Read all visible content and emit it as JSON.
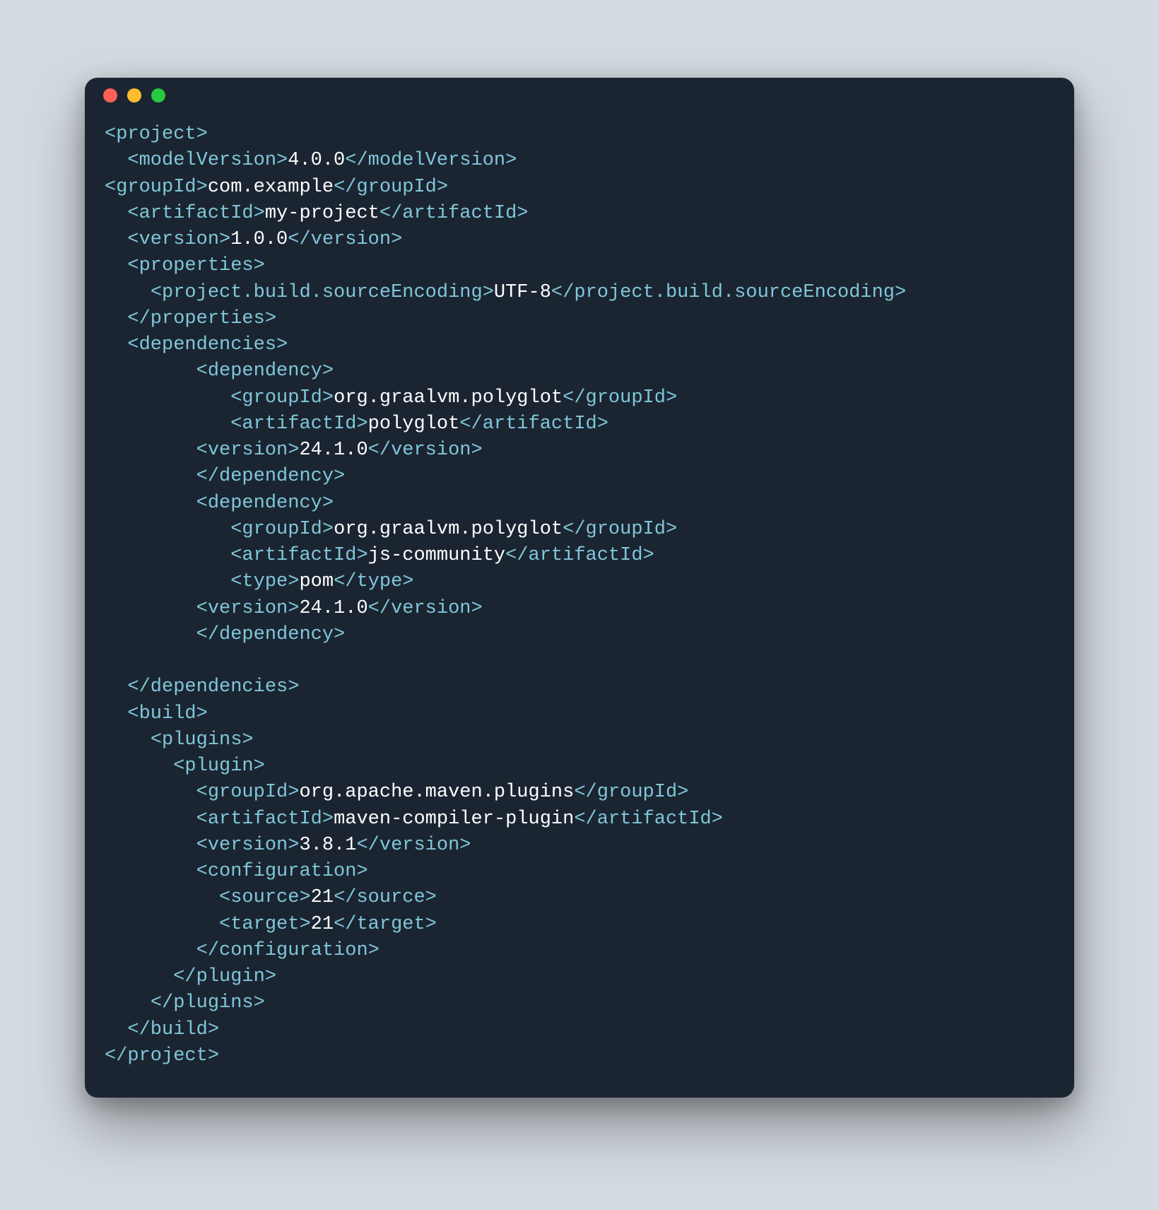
{
  "pom": {
    "modelVersion": "4.0.0",
    "groupId": "com.example",
    "artifactId": "my-project",
    "version": "1.0.0",
    "properties": {
      "project.build.sourceEncoding": "UTF-8"
    },
    "dependencies": [
      {
        "groupId": "org.graalvm.polyglot",
        "artifactId": "polyglot",
        "version": "24.1.0"
      },
      {
        "groupId": "org.graalvm.polyglot",
        "artifactId": "js-community",
        "type": "pom",
        "version": "24.1.0"
      }
    ],
    "build": {
      "plugins": [
        {
          "groupId": "org.apache.maven.plugins",
          "artifactId": "maven-compiler-plugin",
          "version": "3.8.1",
          "configuration": {
            "source": "21",
            "target": "21"
          }
        }
      ]
    }
  },
  "tags": {
    "project_open": "<project>",
    "project_close": "</project>",
    "modelVersion_open": "<modelVersion>",
    "modelVersion_close": "</modelVersion>",
    "groupId_open": "<groupId>",
    "groupId_close": "</groupId>",
    "artifactId_open": "<artifactId>",
    "artifactId_close": "</artifactId>",
    "version_open": "<version>",
    "version_close": "</version>",
    "properties_open": "<properties>",
    "properties_close": "</properties>",
    "pbse_open": "<project.build.sourceEncoding>",
    "pbse_close": "</project.build.sourceEncoding>",
    "dependencies_open": "<dependencies>",
    "dependencies_close": "</dependencies>",
    "dependency_open": "<dependency>",
    "dependency_close": "</dependency>",
    "type_open": "<type>",
    "type_close": "</type>",
    "build_open": "<build>",
    "build_close": "</build>",
    "plugins_open": "<plugins>",
    "plugins_close": "</plugins>",
    "plugin_open": "<plugin>",
    "plugin_close": "</plugin>",
    "configuration_open": "<configuration>",
    "configuration_close": "</configuration>",
    "source_open": "<source>",
    "source_close": "</source>",
    "target_open": "<target>",
    "target_close": "</target>"
  }
}
